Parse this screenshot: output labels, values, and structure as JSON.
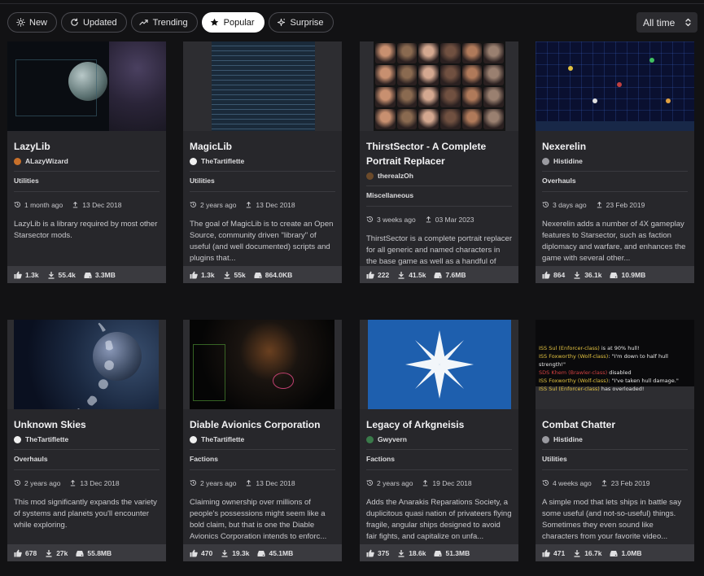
{
  "filters": [
    {
      "label": "New",
      "icon": "sun-icon",
      "active": false
    },
    {
      "label": "Updated",
      "icon": "refresh-icon",
      "active": false
    },
    {
      "label": "Trending",
      "icon": "trending-icon",
      "active": false
    },
    {
      "label": "Popular",
      "icon": "star-icon",
      "active": true
    },
    {
      "label": "Surprise",
      "icon": "sparkle-icon",
      "active": false
    }
  ],
  "sort": {
    "label": "All time"
  },
  "mods": [
    {
      "title": "LazyLib",
      "author": "ALazyWizard",
      "author_color": "#c8702a",
      "category": "Utilities",
      "updated": "1 month ago",
      "created": "13 Dec 2018",
      "description": "LazyLib is a library required by most other Starsector mods.",
      "likes": "1.3k",
      "downloads": "55.4k",
      "size": "3.3MB",
      "thumb": "planet"
    },
    {
      "title": "MagicLib",
      "author": "TheTartiflette",
      "author_color": "#f0f0f0",
      "category": "Utilities",
      "updated": "2 years ago",
      "created": "13 Dec 2018",
      "description": "The goal of MagicLib is to create an Open Source, community driven \"library\" of useful (and well documented) scripts and plugins that...",
      "likes": "1.3k",
      "downloads": "55k",
      "size": "864.0KB",
      "thumb": "code"
    },
    {
      "title": "ThirstSector - A Complete Portrait Replacer",
      "author": "therealzOh",
      "author_color": "#6b4a2a",
      "category": "Miscellaneous",
      "updated": "3 weeks ago",
      "created": "03 Mar 2023",
      "description": "ThirstSector is a complete portrait replacer for all generic and named characters in the base game as well as a handful of mods. This is a SFW mod...",
      "likes": "222",
      "downloads": "41.5k",
      "size": "7.6MB",
      "thumb": "portraits"
    },
    {
      "title": "Nexerelin",
      "author": "Histidine",
      "author_color": "#9a9aa0",
      "category": "Overhauls",
      "updated": "3 days ago",
      "created": "23 Feb 2019",
      "description": "Nexerelin adds a number of 4X gameplay features to Starsector, such as faction diplomacy and warfare, and enhances the game with several other...",
      "likes": "864",
      "downloads": "36.1k",
      "size": "10.9MB",
      "thumb": "starmap"
    },
    {
      "title": "Unknown Skies",
      "author": "TheTartiflette",
      "author_color": "#f0f0f0",
      "category": "Overhauls",
      "updated": "2 years ago",
      "created": "13 Dec 2018",
      "description": "This mod significantly expands the variety of systems and planets you'll encounter while exploring.",
      "likes": "678",
      "downloads": "27k",
      "size": "55.8MB",
      "thumb": "skies"
    },
    {
      "title": "Diable Avionics Corporation",
      "author": "TheTartiflette",
      "author_color": "#f0f0f0",
      "category": "Factions",
      "updated": "2 years ago",
      "created": "13 Dec 2018",
      "description": "Claiming ownership over millions of people's possessions might seem like a bold claim, but that is one the Diable Avionics Corporation intends to enforc...",
      "likes": "470",
      "downloads": "19.3k",
      "size": "45.1MB",
      "thumb": "battle"
    },
    {
      "title": "Legacy of Arkgneisis",
      "author": "Gwyvern",
      "author_color": "#3a7a4a",
      "category": "Factions",
      "updated": "2 years ago",
      "created": "19 Dec 2018",
      "description": "Adds the Anarakis Reparations Society, a duplicitous quasi nation of privateers flying fragile, angular ships designed to avoid fair fights, and capitalize on unfa...",
      "likes": "375",
      "downloads": "18.6k",
      "size": "51.3MB",
      "thumb": "emblem"
    },
    {
      "title": "Combat Chatter",
      "author": "Histidine",
      "author_color": "#9a9aa0",
      "category": "Utilities",
      "updated": "4 weeks ago",
      "created": "23 Feb 2019",
      "description": "A simple mod that lets ships in battle say some useful (and not-so-useful) things. Sometimes they even sound like characters from your favorite video...",
      "likes": "471",
      "downloads": "16.7k",
      "size": "1.0MB",
      "thumb": "chatter"
    }
  ],
  "chatter": [
    {
      "ship": "ISS Sul (Enforcer-class)",
      "msg": " is at 90% hull!",
      "color": "#e0c040"
    },
    {
      "ship": "ISS Foxworthy (Wolf-class)",
      "msg": ": \"I'm down to half hull strength!\"",
      "color": "#e0c040"
    },
    {
      "ship": "SDS Khem (Brawler-class)",
      "msg": " disabled",
      "color": "#d04040"
    },
    {
      "ship": "ISS Foxworthy (Wolf-class)",
      "msg": ": \"I've taken hull damage.\"",
      "color": "#e0c040"
    },
    {
      "ship": "ISS Sul (Enforcer-class)",
      "msg": " has overloaded!",
      "color": "#e0c040"
    }
  ]
}
